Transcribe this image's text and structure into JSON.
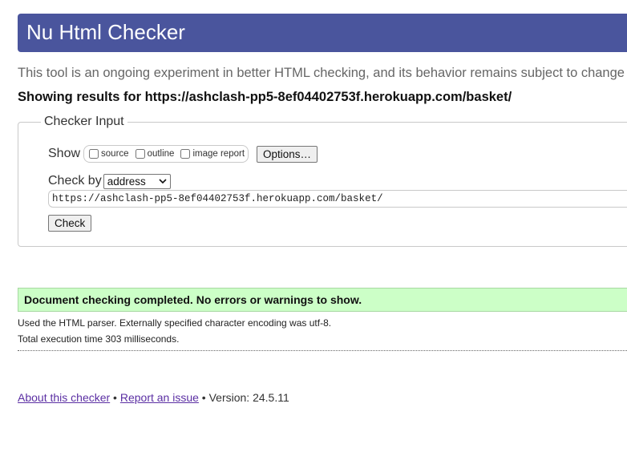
{
  "header": {
    "title": "Nu Html Checker"
  },
  "tagline": "This tool is an ongoing experiment in better HTML checking, and its behavior remains subject to change",
  "results_heading": "Showing results for https://ashclash-pp5-8ef04402753f.herokuapp.com/basket/",
  "checker_input": {
    "legend": "Checker Input",
    "show_label": "Show",
    "show_options": [
      {
        "label": "source",
        "checked": false
      },
      {
        "label": "outline",
        "checked": false
      },
      {
        "label": "image report",
        "checked": false
      }
    ],
    "options_button": "Options…",
    "check_by_label": "Check by",
    "check_by_value": "address",
    "url_value": "https://ashclash-pp5-8ef04402753f.herokuapp.com/basket/",
    "check_button": "Check"
  },
  "results": {
    "success_message": "Document checking completed. No errors or warnings to show.",
    "parser_info": "Used the HTML parser. Externally specified character encoding was utf-8.",
    "execution_time": "Total execution time 303 milliseconds."
  },
  "footer": {
    "about_link": "About this checker",
    "separator1": " • ",
    "report_link": "Report an issue",
    "separator2": " • ",
    "version": "Version: 24.5.11"
  },
  "colors": {
    "header_bg": "#4a559d",
    "success_bg": "#ccffc7",
    "link": "#5b2fa3"
  },
  "icons": {
    "select_arrow": "chevron-down-icon"
  }
}
